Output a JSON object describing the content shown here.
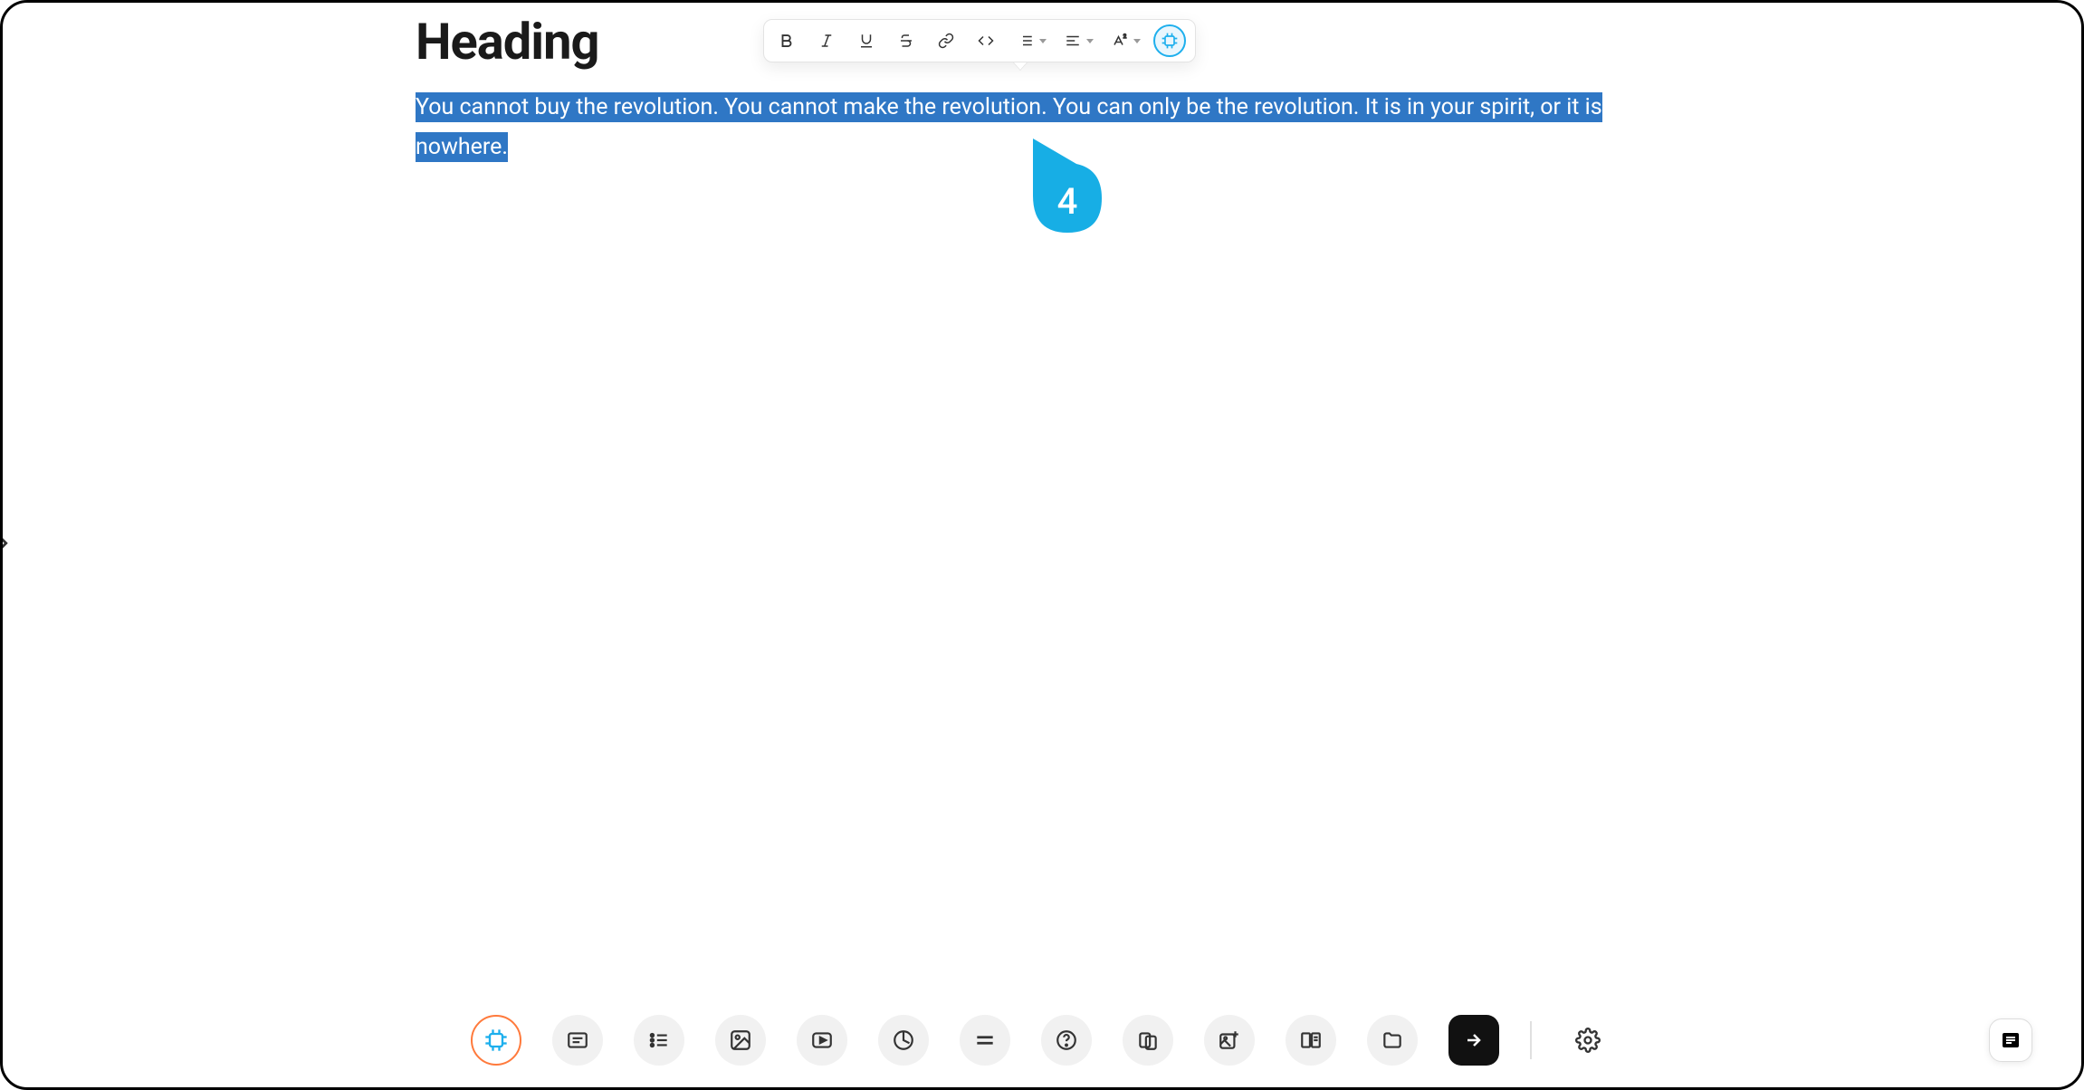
{
  "document": {
    "heading": "Heading",
    "body_text": "You cannot buy the revolution. You cannot make the revolution. You can only be the revolution. It is in your spirit, or it is nowhere."
  },
  "toolbar": {
    "bold": "bold-icon",
    "italic": "italic-icon",
    "underline": "underline-icon",
    "strike": "strikethrough-icon",
    "link": "link-icon",
    "code": "code-icon",
    "list": "list-icon",
    "align": "align-icon",
    "superscript": "superscript-icon",
    "ai": "ai-chip-icon"
  },
  "cursor": {
    "number": "4"
  },
  "bottombar": {
    "items": [
      "ai-chip-icon",
      "text-block-icon",
      "list-block-icon",
      "image-icon",
      "video-icon",
      "chart-icon",
      "divider-icon",
      "question-icon",
      "card-flip-icon",
      "image-plus-icon",
      "columns-icon",
      "folder-icon",
      "submit-icon"
    ],
    "settings": "gear-icon",
    "outline": "list-outline-icon"
  }
}
